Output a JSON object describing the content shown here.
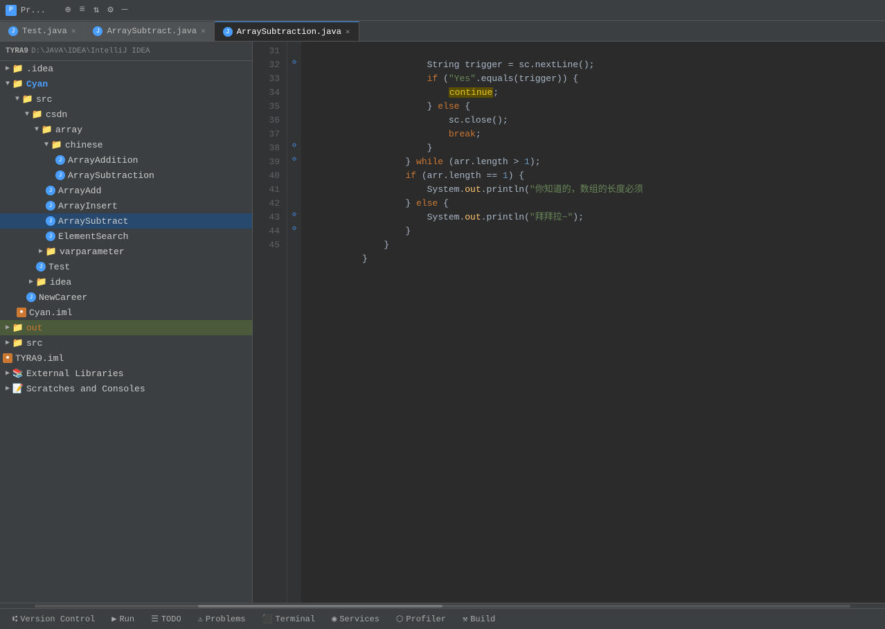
{
  "titleBar": {
    "icon": "P",
    "title": "Pr...",
    "icons": [
      "⊕",
      "≡",
      "⇅",
      "⚙",
      "—"
    ]
  },
  "tabs": [
    {
      "id": "test",
      "label": "Test.java",
      "active": false
    },
    {
      "id": "arraysubtract",
      "label": "ArraySubtract.java",
      "active": false
    },
    {
      "id": "arraysubtraction",
      "label": "ArraySubtraction.java",
      "active": true
    }
  ],
  "sidebar": {
    "projectRoot": "TYRA9",
    "rootPath": "D:\\JAVA\\IDEA\\IntelliJ IDEA",
    "items": [
      {
        "id": "idea",
        "label": ".idea",
        "type": "folder",
        "indent": 0,
        "expanded": false
      },
      {
        "id": "cyan",
        "label": "Cyan",
        "type": "folder-cyan",
        "indent": 0,
        "expanded": true
      },
      {
        "id": "src",
        "label": "src",
        "type": "folder",
        "indent": 1,
        "expanded": true
      },
      {
        "id": "csdn",
        "label": "csdn",
        "type": "folder",
        "indent": 2,
        "expanded": true
      },
      {
        "id": "array",
        "label": "array",
        "type": "folder",
        "indent": 3,
        "expanded": true
      },
      {
        "id": "chinese",
        "label": "chinese",
        "type": "folder",
        "indent": 4,
        "expanded": true
      },
      {
        "id": "arrayadd",
        "label": "ArrayAddition",
        "type": "java",
        "indent": 5
      },
      {
        "id": "arraysubtraction-file",
        "label": "ArraySubtraction",
        "type": "java",
        "indent": 5
      },
      {
        "id": "arrayadd2",
        "label": "ArrayAdd",
        "type": "java",
        "indent": 4
      },
      {
        "id": "arrayinsert",
        "label": "ArrayInsert",
        "type": "java",
        "indent": 4
      },
      {
        "id": "arraysubtract-file",
        "label": "ArraySubtract",
        "type": "java",
        "indent": 4,
        "selected": true
      },
      {
        "id": "elementsearch",
        "label": "ElementSearch",
        "type": "java",
        "indent": 4
      },
      {
        "id": "varparameter",
        "label": "varparameter",
        "type": "folder",
        "indent": 3,
        "expanded": false
      },
      {
        "id": "test-file",
        "label": "Test",
        "type": "java",
        "indent": 3
      },
      {
        "id": "idea2",
        "label": "idea",
        "type": "folder",
        "indent": 2,
        "expanded": false
      },
      {
        "id": "newcareer",
        "label": "NewCareer",
        "type": "java",
        "indent": 2
      },
      {
        "id": "cyan-iml",
        "label": "Cyan.iml",
        "type": "iml",
        "indent": 1
      },
      {
        "id": "out",
        "label": "out",
        "type": "folder-orange",
        "indent": 0,
        "expanded": false
      },
      {
        "id": "src2",
        "label": "src",
        "type": "folder-cyan",
        "indent": 0,
        "expanded": false
      },
      {
        "id": "tyra9-iml",
        "label": "TYRA9.iml",
        "type": "iml",
        "indent": 0
      },
      {
        "id": "ext-libs",
        "label": "External Libraries",
        "type": "ext",
        "indent": 0
      },
      {
        "id": "scratches",
        "label": "Scratches and Consoles",
        "type": "ext",
        "indent": 0
      }
    ]
  },
  "codeLines": [
    {
      "num": 31,
      "tokens": [
        {
          "t": "plain",
          "v": "            String trigger = sc.nextLine();"
        }
      ],
      "gutter": ""
    },
    {
      "num": 32,
      "tokens": [
        {
          "t": "plain",
          "v": "            "
        },
        {
          "t": "kw",
          "v": "if"
        },
        {
          "t": "plain",
          "v": " ("
        },
        {
          "t": "str",
          "v": "\"Yes\""
        },
        {
          "t": "plain",
          "v": ".equals(trigger)) {"
        }
      ],
      "gutter": "arrow"
    },
    {
      "num": 33,
      "tokens": [
        {
          "t": "plain",
          "v": "                "
        },
        {
          "t": "hl-continue",
          "v": "continue"
        },
        {
          "t": "plain",
          "v": ";"
        }
      ],
      "gutter": ""
    },
    {
      "num": 34,
      "tokens": [
        {
          "t": "plain",
          "v": "            } "
        },
        {
          "t": "kw",
          "v": "else"
        },
        {
          "t": "plain",
          "v": " {"
        }
      ],
      "gutter": ""
    },
    {
      "num": 35,
      "tokens": [
        {
          "t": "plain",
          "v": "                sc.close();"
        }
      ],
      "gutter": ""
    },
    {
      "num": 36,
      "tokens": [
        {
          "t": "plain",
          "v": "                "
        },
        {
          "t": "kw",
          "v": "break"
        },
        {
          "t": "plain",
          "v": ";"
        }
      ],
      "gutter": ""
    },
    {
      "num": 37,
      "tokens": [
        {
          "t": "plain",
          "v": "            }"
        }
      ],
      "gutter": ""
    },
    {
      "num": 38,
      "tokens": [
        {
          "t": "plain",
          "v": "        } "
        },
        {
          "t": "kw",
          "v": "while"
        },
        {
          "t": "plain",
          "v": " (arr.length > "
        },
        {
          "t": "num",
          "v": "1"
        },
        {
          "t": "plain",
          "v": ");"
        }
      ],
      "gutter": "arrow"
    },
    {
      "num": 39,
      "tokens": [
        {
          "t": "kw",
          "v": "        if"
        },
        {
          "t": "plain",
          "v": " (arr.length == "
        },
        {
          "t": "num",
          "v": "1"
        },
        {
          "t": "plain",
          "v": ") {"
        }
      ],
      "gutter": "arrow"
    },
    {
      "num": 40,
      "tokens": [
        {
          "t": "plain",
          "v": "            System."
        },
        {
          "t": "fn",
          "v": "out"
        },
        {
          "t": "plain",
          "v": ".println("
        },
        {
          "t": "str",
          "v": "\"你知道的，数组的长度必须"
        }
      ],
      "gutter": ""
    },
    {
      "num": 41,
      "tokens": [
        {
          "t": "plain",
          "v": "        } "
        },
        {
          "t": "kw",
          "v": "else"
        },
        {
          "t": "plain",
          "v": " {"
        }
      ],
      "gutter": ""
    },
    {
      "num": 42,
      "tokens": [
        {
          "t": "plain",
          "v": "            System."
        },
        {
          "t": "fn",
          "v": "out"
        },
        {
          "t": "plain",
          "v": ".println("
        },
        {
          "t": "str",
          "v": "\"拜拜拉~\""
        },
        {
          "t": "plain",
          "v": ");"
        }
      ],
      "gutter": ""
    },
    {
      "num": 43,
      "tokens": [
        {
          "t": "plain",
          "v": "        }"
        }
      ],
      "gutter": "arrow"
    },
    {
      "num": 44,
      "tokens": [
        {
          "t": "plain",
          "v": "    }"
        }
      ],
      "gutter": "arrow"
    },
    {
      "num": 45,
      "tokens": [
        {
          "t": "plain",
          "v": "}"
        }
      ],
      "gutter": ""
    }
  ],
  "bottomTabs": [
    {
      "id": "version-control",
      "icon": "⑆",
      "label": "Version Control"
    },
    {
      "id": "run",
      "icon": "▶",
      "label": "Run"
    },
    {
      "id": "todo",
      "icon": "☰",
      "label": "TODO"
    },
    {
      "id": "problems",
      "icon": "⚠",
      "label": "Problems"
    },
    {
      "id": "terminal",
      "icon": ">_",
      "label": "Terminal"
    },
    {
      "id": "services",
      "icon": "◉",
      "label": "Services"
    },
    {
      "id": "profiler",
      "icon": "⬡",
      "label": "Profiler"
    },
    {
      "id": "build",
      "icon": "⚒",
      "label": "Build"
    }
  ]
}
